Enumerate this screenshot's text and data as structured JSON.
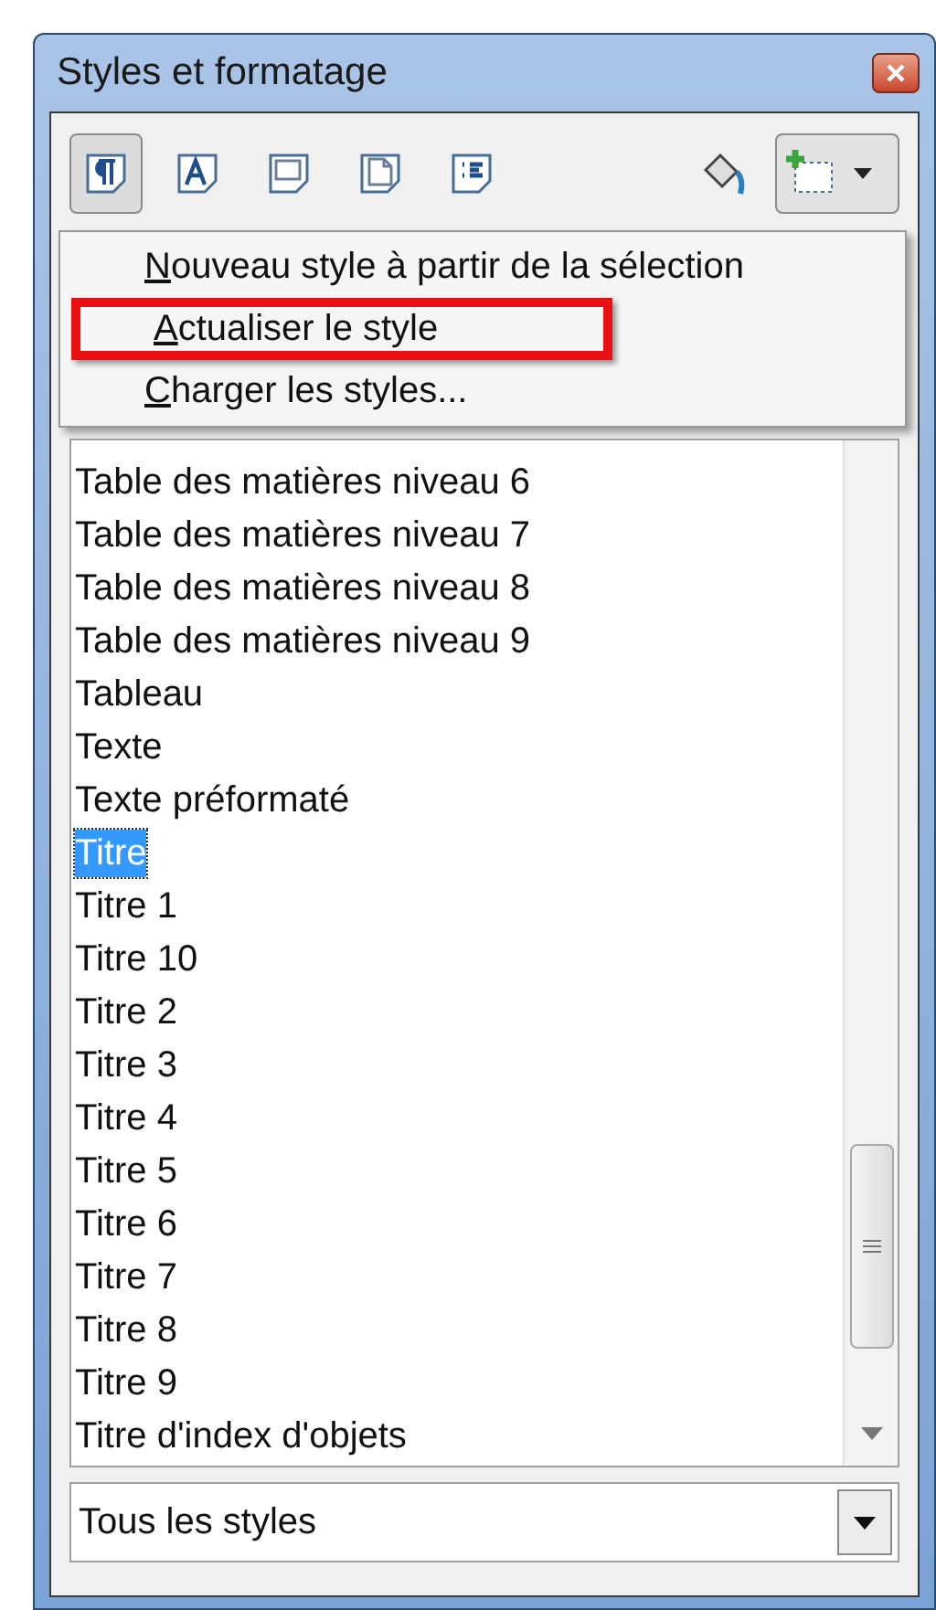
{
  "window": {
    "title": "Styles et formatage"
  },
  "toolbar": {
    "families": [
      {
        "selected": true
      },
      {
        "selected": false
      },
      {
        "selected": false
      },
      {
        "selected": false
      },
      {
        "selected": false
      }
    ],
    "new_style_pressed": true
  },
  "menu": [
    {
      "label": "Nouveau style à partir de la sélection",
      "highlighted": false
    },
    {
      "label": "Actualiser le style",
      "highlighted": true
    },
    {
      "label": "Charger les styles...",
      "highlighted": false
    }
  ],
  "styles": [
    {
      "label": "Table des matières niveau 6",
      "selected": false
    },
    {
      "label": "Table des matières niveau 7",
      "selected": false
    },
    {
      "label": "Table des matières niveau 8",
      "selected": false
    },
    {
      "label": "Table des matières niveau 9",
      "selected": false
    },
    {
      "label": "Tableau",
      "selected": false
    },
    {
      "label": "Texte",
      "selected": false
    },
    {
      "label": "Texte préformaté",
      "selected": false
    },
    {
      "label": "Titre",
      "selected": true
    },
    {
      "label": "Titre 1",
      "selected": false
    },
    {
      "label": "Titre 10",
      "selected": false
    },
    {
      "label": "Titre 2",
      "selected": false
    },
    {
      "label": "Titre 3",
      "selected": false
    },
    {
      "label": "Titre 4",
      "selected": false
    },
    {
      "label": "Titre 5",
      "selected": false
    },
    {
      "label": "Titre 6",
      "selected": false
    },
    {
      "label": "Titre 7",
      "selected": false
    },
    {
      "label": "Titre 8",
      "selected": false
    },
    {
      "label": "Titre 9",
      "selected": false
    },
    {
      "label": "Titre d'index d'objets",
      "selected": false
    }
  ],
  "filter": {
    "value": "Tous les styles"
  }
}
